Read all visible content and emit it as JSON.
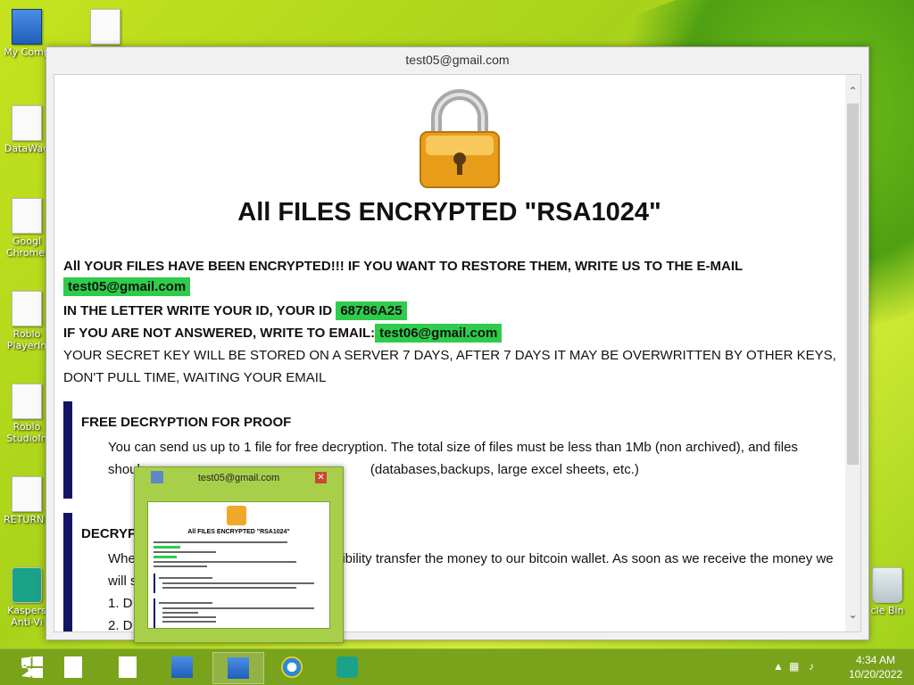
{
  "window": {
    "title": "test05@gmail.com",
    "heading": "All FILES ENCRYPTED \"RSA1024\"",
    "line1": "All YOUR FILES HAVE BEEN ENCRYPTED!!! IF YOU WANT TO RESTORE THEM, WRITE US TO THE E-MAIL",
    "email1": "test05@gmail.com",
    "line2": "IN THE LETTER WRITE YOUR ID, YOUR ID",
    "id": "68786A25",
    "line3": "IF YOU ARE NOT ANSWERED, WRITE TO EMAIL:",
    "email2": "test06@gmail.com",
    "line4": "YOUR SECRET KEY WILL BE STORED ON A SERVER 7 DAYS, AFTER 7 DAYS IT MAY BE OVERWRITTEN BY OTHER KEYS,",
    "line5": "DON'T PULL TIME, WAITING YOUR EMAIL",
    "section1": {
      "heading": "FREE DECRYPTION FOR PROOF",
      "text1": "You can send us up to 1 file for free decryption. The total size of files must be less than 1Mb (non archived), and files",
      "text2_a": "shoul",
      "text2_b": "(databases,backups, large excel sheets, etc.)"
    },
    "section2": {
      "heading_part": "DECRYP",
      "text1_a": "Whe",
      "text1_b": "sibility transfer the money to our bitcoin wallet. As soon as we receive the money we",
      "text2": "will s",
      "item1": "1. D",
      "item2": "2. D"
    }
  },
  "preview": {
    "title": "test05@gmail.com",
    "heading": "All FILES ENCRYPTED \"RSA1024\""
  },
  "desktop_icons": [
    {
      "label": "My Comp"
    },
    {
      "label": "DataWag"
    },
    {
      "label": "Googl Chromel"
    },
    {
      "label": "Roblo PlayerIn"
    },
    {
      "label": "Roblo StudioIn"
    },
    {
      "label": "RETURN I"
    },
    {
      "label": "Kaspers Anti-Vi"
    },
    {
      "label": "cle Bin"
    }
  ],
  "taskbar": {
    "time": "4:34 AM",
    "date": "10/20/2022"
  }
}
